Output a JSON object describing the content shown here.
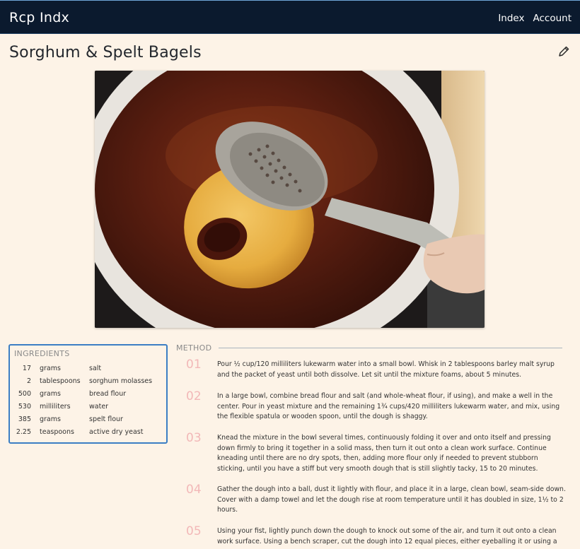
{
  "navbar": {
    "brand": "Rcp Indx",
    "links": [
      "Index",
      "Account"
    ]
  },
  "recipe": {
    "title": "Sorghum & Spelt Bagels",
    "edit_icon": "pencil-icon",
    "image_alt": "bagel-boiling-in-pot"
  },
  "ingredients": {
    "title": "INGREDIENTS",
    "rows": [
      {
        "qty": "17",
        "unit": "grams",
        "item": "salt"
      },
      {
        "qty": "2",
        "unit": "tablespoons",
        "item": "sorghum molasses"
      },
      {
        "qty": "500",
        "unit": "grams",
        "item": "bread flour"
      },
      {
        "qty": "530",
        "unit": "milliliters",
        "item": "water"
      },
      {
        "qty": "385",
        "unit": "grams",
        "item": "spelt flour"
      },
      {
        "qty": "2.25",
        "unit": "teaspoons",
        "item": "active dry yeast"
      }
    ]
  },
  "method": {
    "title": "METHOD",
    "steps": [
      {
        "num": "01",
        "text": "Pour ½ cup/120 milliliters lukewarm water into a small bowl. Whisk in 2 tablespoons barley malt syrup and the packet of yeast until both dissolve. Let sit until the mixture foams, about 5 minutes."
      },
      {
        "num": "02",
        "text": "In a large bowl, combine bread flour and salt (and whole-wheat flour, if using), and make a well in the center. Pour in yeast mixture and the remaining 1¾ cups/420 milliliters lukewarm water, and mix, using the flexible spatula or wooden spoon, until the dough is shaggy."
      },
      {
        "num": "03",
        "text": "Knead the mixture in the bowl several times, continuously folding it over and onto itself and pressing down firmly to bring it together in a solid mass, then turn it out onto a clean work surface. Continue kneading until there are no dry spots, then, adding more flour only if needed to prevent stubborn sticking, until you have a stiff but very smooth dough that is still slightly tacky, 15 to 20 minutes."
      },
      {
        "num": "04",
        "text": "Gather the dough into a ball, dust it lightly with flour, and place it in a large, clean bowl, seam-side down. Cover with a damp towel and let the dough rise at room temperature until it has doubled in size, 1½ to 2 hours."
      },
      {
        "num": "05",
        "text": "Using your fist, lightly punch down the dough to knock out some of the air, and turn it out onto a clean work surface. Using a bench scraper, cut the dough into 12 equal pieces, either eyeballing it or using a"
      }
    ]
  }
}
